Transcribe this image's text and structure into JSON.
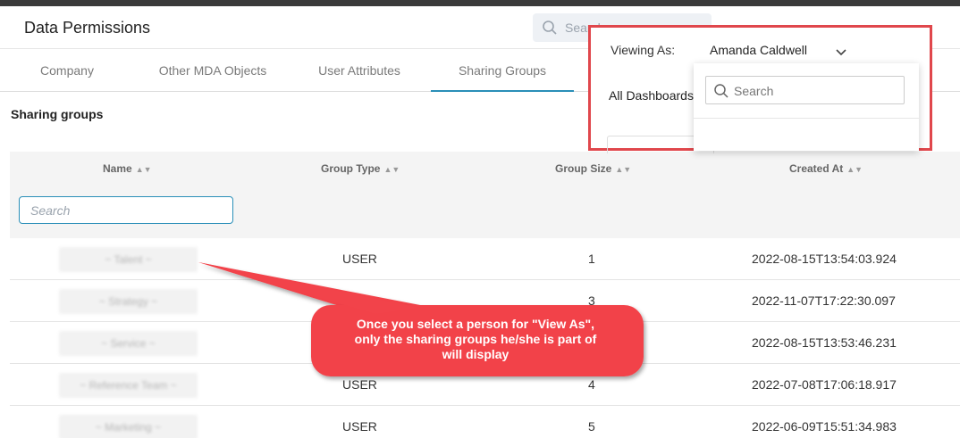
{
  "header": {
    "title": "Data Permissions",
    "search_placeholder": "Search"
  },
  "tabs": [
    {
      "label": "Company"
    },
    {
      "label": "Other MDA Objects"
    },
    {
      "label": "User Attributes"
    },
    {
      "label": "Sharing Groups",
      "active": true
    }
  ],
  "section_title": "Sharing groups",
  "table": {
    "columns": [
      {
        "label": "Name"
      },
      {
        "label": "Group Type"
      },
      {
        "label": "Group Size"
      },
      {
        "label": "Created At"
      }
    ],
    "name_search_placeholder": "Search",
    "rows": [
      {
        "name": "~ Talent ~",
        "group_type": "USER",
        "group_size": "1",
        "created_at": "2022-08-15T13:54:03.924"
      },
      {
        "name": "~ Strategy ~",
        "group_type": "",
        "group_size": "3",
        "created_at": "2022-11-07T17:22:30.097"
      },
      {
        "name": "~ Service ~",
        "group_type": "",
        "group_size": "",
        "created_at": "2022-08-15T13:53:46.231"
      },
      {
        "name": "~ Reference Team ~",
        "group_type": "USER",
        "group_size": "4",
        "created_at": "2022-07-08T17:06:18.917"
      },
      {
        "name": "~ Marketing ~",
        "group_type": "USER",
        "group_size": "5",
        "created_at": "2022-06-09T15:51:34.983"
      }
    ]
  },
  "view_as": {
    "label": "Viewing As:",
    "value": "Amanda Caldwell",
    "dashboards_label": "All Dashboards",
    "dropdown_search_placeholder": "Search"
  },
  "callout": {
    "line1": "Once you select a person for \"View As\",",
    "line2": "only the sharing groups he/she is part of",
    "line3": "will display"
  },
  "colors": {
    "accent": "#2a8fb8",
    "highlight": "#e0474c",
    "callout_fill": "#f2434a"
  }
}
